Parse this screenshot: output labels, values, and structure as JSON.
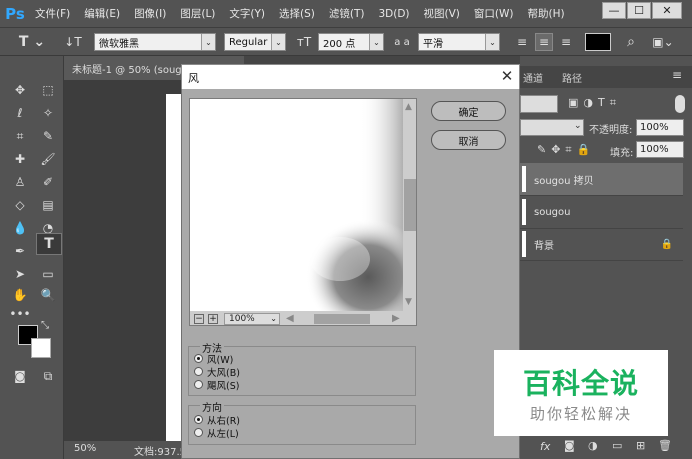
{
  "app": {
    "logo": "Ps",
    "menus": [
      "文件(F)",
      "编辑(E)",
      "图像(I)",
      "图层(L)",
      "文字(Y)",
      "选择(S)",
      "滤镜(T)",
      "3D(D)",
      "视图(V)",
      "窗口(W)",
      "帮助(H)"
    ]
  },
  "options": {
    "font_family": "微软雅黑",
    "font_style": "Regular",
    "font_size": "200 点",
    "aa_label": "a a",
    "antialias": "平滑",
    "text_color": "#000000"
  },
  "document": {
    "tab_title": "未标题-1 @ 50% (soug",
    "zoom": "50%",
    "doc_info": "文档:937.5"
  },
  "panels": {
    "tabs": [
      "通道",
      "路径"
    ],
    "opacity_label": "不透明度:",
    "opacity_value": "100%",
    "fill_label": "填充:",
    "fill_value": "100%",
    "layers": [
      "sougou 拷贝",
      "sougou",
      "背景"
    ],
    "fx_label": "fx"
  },
  "dialog": {
    "title": "风",
    "ok_label": "确定",
    "cancel_label": "取消",
    "preview_zoom": "100%",
    "method": {
      "label": "方法",
      "options": [
        "风(W)",
        "大风(B)",
        "飓风(S)"
      ],
      "selected": 0
    },
    "direction": {
      "label": "方向",
      "options": [
        "从右(R)",
        "从左(L)"
      ],
      "selected": 0
    }
  },
  "watermark": {
    "main": "百科全说",
    "sub": "助你轻松解决",
    "color": "#1ab25e"
  }
}
